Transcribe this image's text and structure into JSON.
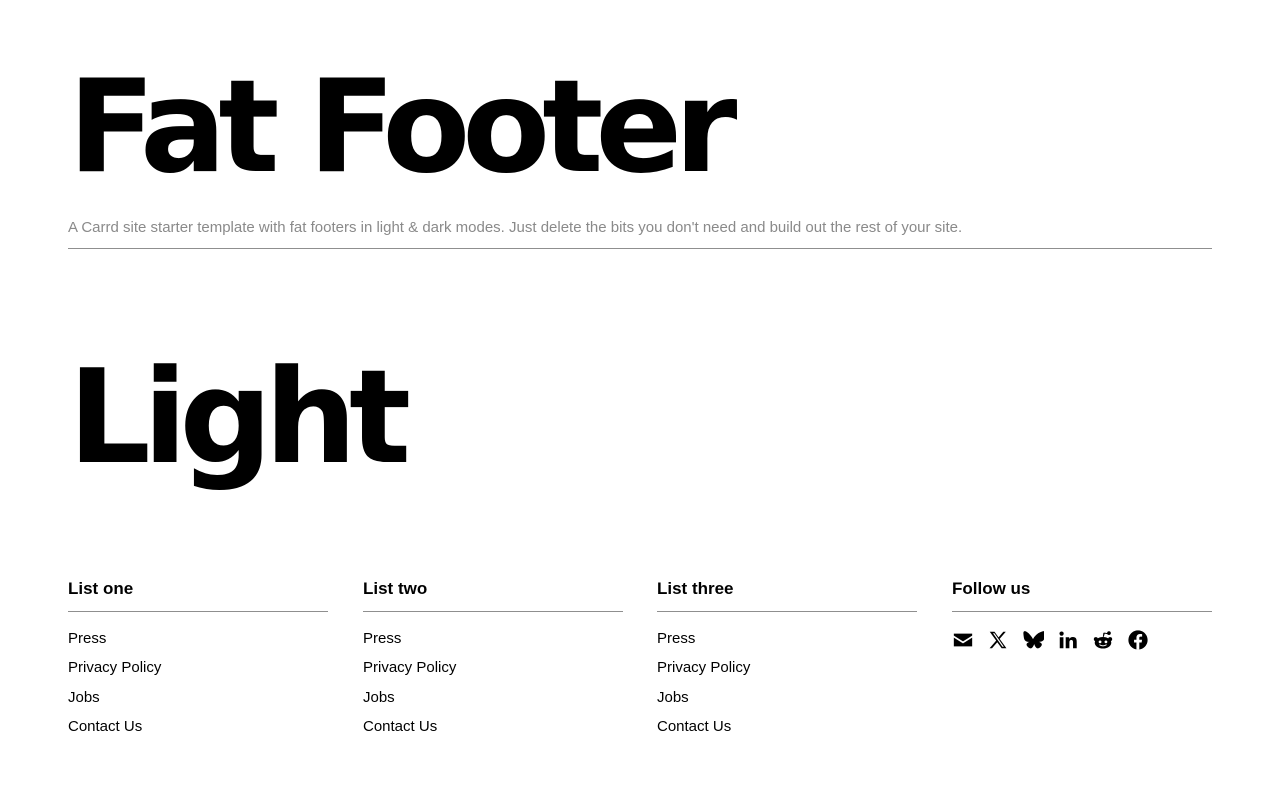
{
  "hero": {
    "title": "Fat Footer",
    "subtitle": "A Carrd site starter template with fat footers in light & dark modes. Just delete the bits you don't need and build out the rest of your site."
  },
  "section": {
    "title": "Light"
  },
  "footer": {
    "columns": [
      {
        "heading": "List one",
        "links": [
          "Press",
          "Privacy Policy",
          "Jobs",
          "Contact Us"
        ]
      },
      {
        "heading": "List two",
        "links": [
          "Press",
          "Privacy Policy",
          "Jobs",
          "Contact Us"
        ]
      },
      {
        "heading": "List three",
        "links": [
          "Press",
          "Privacy Policy",
          "Jobs",
          "Contact Us"
        ]
      }
    ],
    "follow": {
      "heading": "Follow us",
      "icons": [
        "email-icon",
        "x-icon",
        "bluesky-icon",
        "linkedin-icon",
        "reddit-icon",
        "facebook-icon"
      ]
    }
  },
  "colors": {
    "text": "#000000",
    "muted": "#8a8a8a",
    "rule": "#8f8f8f",
    "background": "#ffffff"
  }
}
